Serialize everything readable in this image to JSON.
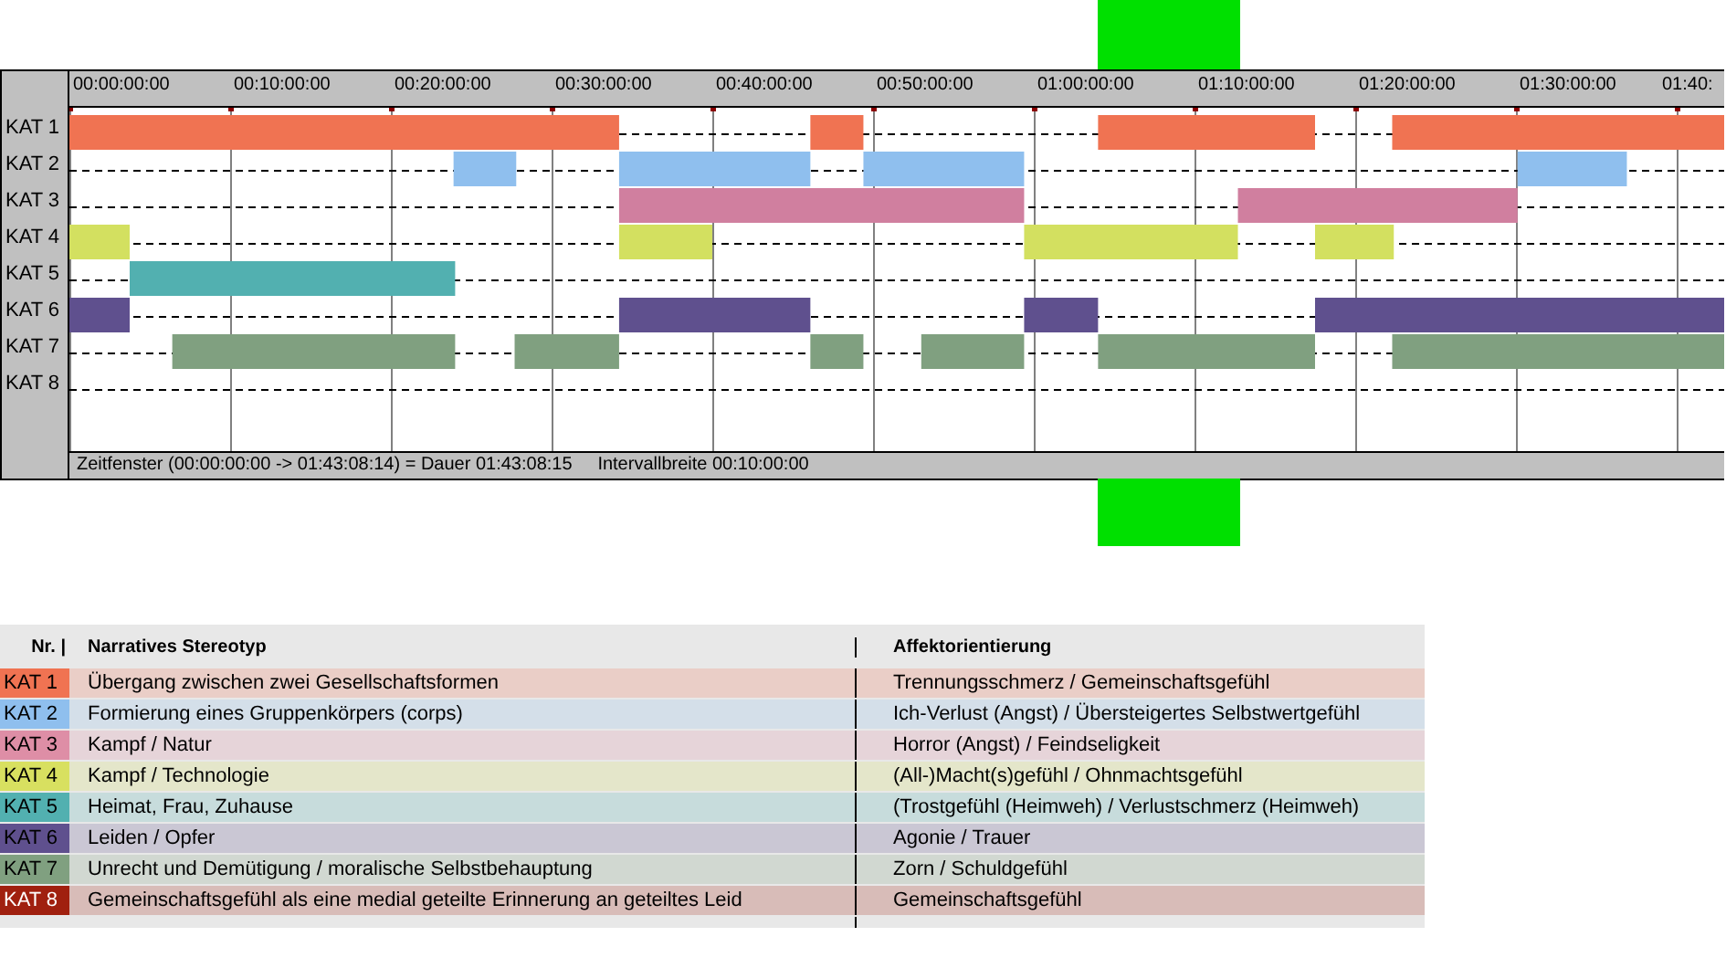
{
  "timeline": {
    "ticks": [
      "00:00:00:00",
      "00:10:00:00",
      "00:20:00:00",
      "00:30:00:00",
      "00:40:00:00",
      "00:50:00:00",
      "01:00:00:00",
      "01:10:00:00",
      "01:20:00:00",
      "01:30:00:00",
      "01:40:"
    ],
    "rows": [
      {
        "label": "KAT 1",
        "color": "#f07352"
      },
      {
        "label": "KAT 2",
        "color": "#8fbfee"
      },
      {
        "label": "KAT 3",
        "color": "#d07f9f"
      },
      {
        "label": "KAT 4",
        "color": "#d3e060"
      },
      {
        "label": "KAT 5",
        "color": "#52b0b0"
      },
      {
        "label": "KAT 6",
        "color": "#5f508e"
      },
      {
        "label": "KAT 7",
        "color": "#80a080"
      },
      {
        "label": "KAT 8"
      }
    ],
    "status": "Zeitfenster (00:00:00:00 -> 01:43:08:14) = Dauer 01:43:08:15     Intervallbreite 00:10:00:00"
  },
  "legend": {
    "columns": [
      "Nr. |",
      "Narratives Stereotyp",
      "Affektorientierung"
    ],
    "rows": [
      {
        "nr": "KAT 1",
        "color": "#f07352",
        "stereotype": "Übergang zwischen zwei Gesellschaftsformen",
        "affect": "Trennungsschmerz / Gemeinschaftsgefühl"
      },
      {
        "nr": "KAT 2",
        "color": "#8fbfee",
        "stereotype": "Formierung eines Gruppenkörpers (corps)",
        "affect": "Ich-Verlust (Angst) / Übersteigertes Selbstwertgefühl"
      },
      {
        "nr": "KAT 3",
        "color": "#de8ea6",
        "stereotype": "Kampf / Natur",
        "affect": "Horror (Angst) / Feindseligkeit"
      },
      {
        "nr": "KAT 4",
        "color": "#d8e060",
        "stereotype": "Kampf / Technologie",
        "affect": "(All-)Macht(s)gefühl / Ohnmachtsgefühl"
      },
      {
        "nr": "KAT 5",
        "color": "#52b0b0",
        "stereotype": "Heimat, Frau, Zuhause",
        "affect": "(Trostgefühl (Heimweh) / Verlustschmerz (Heimweh)"
      },
      {
        "nr": "KAT 6",
        "color": "#5f508e",
        "stereotype": "Leiden / Opfer",
        "affect": "Agonie / Trauer"
      },
      {
        "nr": "KAT 7",
        "color": "#80a080",
        "stereotype": "Unrecht und Demütigung / moralische Selbstbehauptung",
        "affect": "Zorn / Schuldgefühl"
      },
      {
        "nr": "KAT 8",
        "color": "#a0200f",
        "stereotype": "Gemeinschaftsgefühl als eine medial geteilte Erinnerung an geteiltes Leid",
        "affect": "Gemeinschaftsgefühl"
      }
    ]
  }
}
